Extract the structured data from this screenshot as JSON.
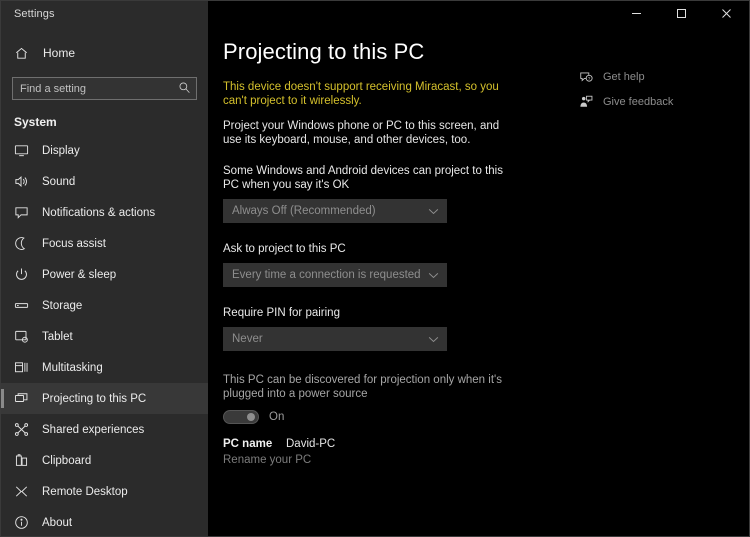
{
  "titlebar": {
    "title": "Settings",
    "minimize_label": "Minimize",
    "maximize_label": "Maximize",
    "close_label": "Close"
  },
  "sidebar": {
    "home_label": "Home",
    "home_icon": "home-icon",
    "search": {
      "placeholder": "Find a setting",
      "value": "",
      "icon": "search-icon"
    },
    "section_title": "System",
    "items": [
      {
        "label": "Display",
        "icon": "monitor-icon",
        "selected": false
      },
      {
        "label": "Sound",
        "icon": "speaker-icon",
        "selected": false
      },
      {
        "label": "Notifications & actions",
        "icon": "notification-icon",
        "selected": false
      },
      {
        "label": "Focus assist",
        "icon": "moon-icon",
        "selected": false
      },
      {
        "label": "Power & sleep",
        "icon": "power-icon",
        "selected": false
      },
      {
        "label": "Storage",
        "icon": "storage-icon",
        "selected": false
      },
      {
        "label": "Tablet",
        "icon": "tablet-icon",
        "selected": false
      },
      {
        "label": "Multitasking",
        "icon": "multitasking-icon",
        "selected": false
      },
      {
        "label": "Projecting to this PC",
        "icon": "projecting-icon",
        "selected": true
      },
      {
        "label": "Shared experiences",
        "icon": "shared-experiences-icon",
        "selected": false
      },
      {
        "label": "Clipboard",
        "icon": "clipboard-icon",
        "selected": false
      },
      {
        "label": "Remote Desktop",
        "icon": "remote-desktop-icon",
        "selected": false
      },
      {
        "label": "About",
        "icon": "info-icon",
        "selected": false
      }
    ]
  },
  "main": {
    "page_title": "Projecting to this PC",
    "warning_text": "This device doesn't support receiving Miracast, so you can't project to it wirelessly.",
    "description_text": "Project your Windows phone or PC to this screen, and use its keyboard, mouse, and other devices, too.",
    "fields": [
      {
        "label": "Some Windows and Android devices can project to this PC when you say it's OK",
        "value": "Always Off (Recommended)",
        "disabled": true
      },
      {
        "label": "Ask to project to this PC",
        "value": "Every time a connection is requested",
        "disabled": true
      },
      {
        "label": "Require PIN for pairing",
        "value": "Never",
        "disabled": true
      }
    ],
    "toggle": {
      "label": "This PC can be discovered for projection only when it's plugged into a power source",
      "state_label": "On",
      "on": true,
      "disabled": true
    },
    "pc_name": {
      "key": "PC name",
      "value": "David-PC",
      "rename_link": "Rename your PC"
    }
  },
  "help_pane": {
    "items": [
      {
        "label": "Get help",
        "icon": "help-bubble-icon"
      },
      {
        "label": "Give feedback",
        "icon": "feedback-person-icon"
      }
    ]
  },
  "colors": {
    "sidebar_bg": "#2b2b2b",
    "content_bg": "#000000",
    "warning": "#d4c02c",
    "control_bg": "#333333",
    "selected_item_bg": "#383838"
  }
}
